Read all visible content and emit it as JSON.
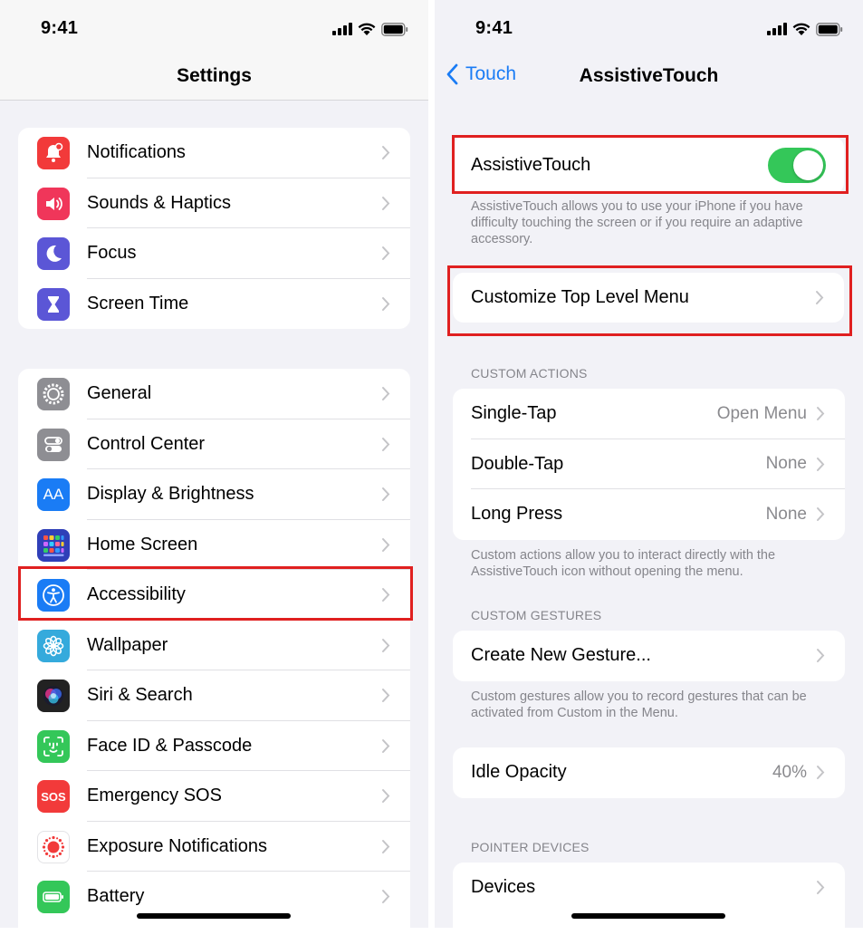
{
  "left": {
    "status_time": "9:41",
    "title": "Settings",
    "group1": [
      {
        "label": "Notifications",
        "icon": "bell-icon",
        "color": "#f23a3a"
      },
      {
        "label": "Sounds & Haptics",
        "icon": "speaker-icon",
        "color": "#f0365a"
      },
      {
        "label": "Focus",
        "icon": "moon-icon",
        "color": "#5b56d6"
      },
      {
        "label": "Screen Time",
        "icon": "hourglass-icon",
        "color": "#5b56d6"
      }
    ],
    "group2": [
      {
        "label": "General",
        "icon": "gear-icon",
        "color": "#8e8e93"
      },
      {
        "label": "Control Center",
        "icon": "switches-icon",
        "color": "#8e8e93"
      },
      {
        "label": "Display & Brightness",
        "icon": "text-size-icon",
        "color": "#1a7cf5",
        "glyph": "AA"
      },
      {
        "label": "Home Screen",
        "icon": "app-grid-icon",
        "color": "#2f3fb8"
      },
      {
        "label": "Accessibility",
        "icon": "accessibility-icon",
        "color": "#1a7cf5"
      },
      {
        "label": "Wallpaper",
        "icon": "flower-icon",
        "color": "#35aadc"
      },
      {
        "label": "Siri & Search",
        "icon": "siri-icon",
        "color": "#222222"
      },
      {
        "label": "Face ID & Passcode",
        "icon": "face-id-icon",
        "color": "#34c759"
      },
      {
        "label": "Emergency SOS",
        "icon": "sos-icon",
        "color": "#f23a3a",
        "glyph": "SOS"
      },
      {
        "label": "Exposure Notifications",
        "icon": "exposure-icon",
        "color": "#ffffff"
      },
      {
        "label": "Battery",
        "icon": "battery-icon",
        "color": "#34c759"
      }
    ]
  },
  "right": {
    "status_time": "9:41",
    "back_label": "Touch",
    "title": "AssistiveTouch",
    "assistive_label": "AssistiveTouch",
    "assistive_on": true,
    "assistive_note": "AssistiveTouch allows you to use your iPhone if you have difficulty touching the screen or if you require an adaptive accessory.",
    "customize_label": "Customize Top Level Menu",
    "custom_actions_header": "CUSTOM ACTIONS",
    "actions": [
      {
        "label": "Single-Tap",
        "value": "Open Menu"
      },
      {
        "label": "Double-Tap",
        "value": "None"
      },
      {
        "label": "Long Press",
        "value": "None"
      }
    ],
    "actions_note": "Custom actions allow you to interact directly with the AssistiveTouch icon without opening the menu.",
    "custom_gestures_header": "CUSTOM GESTURES",
    "create_gesture_label": "Create New Gesture...",
    "gestures_note": "Custom gestures allow you to record gestures that can be activated from Custom in the Menu.",
    "idle_opacity_label": "Idle Opacity",
    "idle_opacity_value": "40%",
    "pointer_devices_header": "POINTER DEVICES",
    "devices_label": "Devices"
  },
  "colors": {
    "accent": "#1a7cf5",
    "toggle_on": "#34c759",
    "highlight": "#e02020"
  }
}
